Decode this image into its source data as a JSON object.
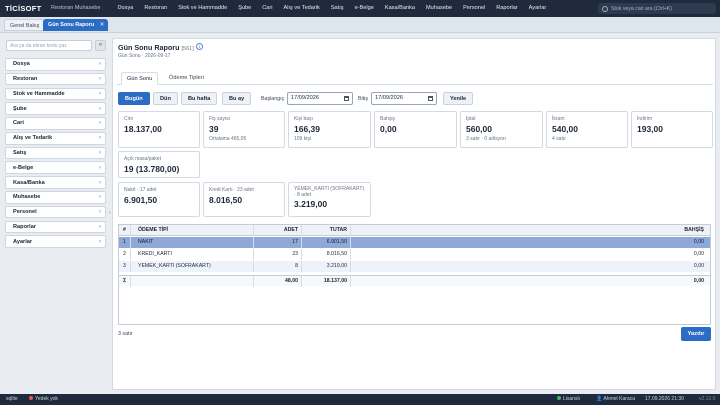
{
  "app": {
    "logo": "TİCİSOFT",
    "subtitle": "Restoran Muhasebe"
  },
  "menu": [
    "Dosya",
    "Restoran",
    "Stok ve Hammadde",
    "Şube",
    "Cari",
    "Alış ve Tedarik",
    "Satış",
    "e-Belge",
    "Kasa/Banka",
    "Muhasebe",
    "Personel",
    "Raporlar",
    "Ayarlar"
  ],
  "global_search": {
    "placeholder": "Stok veya cari ara (Ctrl+K)",
    "icon": "search-icon"
  },
  "page_tabs": [
    {
      "label": "Genel Bakış"
    },
    {
      "label": "Gün Sonu Raporu",
      "close": "✕"
    }
  ],
  "sidebar": {
    "search_placeholder": "Ara ya da ekran kodu yaz",
    "collapse": "«",
    "items": [
      "Dosya",
      "Restoran",
      "Stok ve Hammadde",
      "Şube",
      "Cari",
      "Alış ve Tedarik",
      "Satış",
      "e-Belge",
      "Kasa/Banka",
      "Muhasebe",
      "Personel",
      "Raporlar",
      "Ayarlar"
    ],
    "chevron": "›",
    "splitter": "‹"
  },
  "report": {
    "title": "Gün Sonu Raporu",
    "code": "[561]",
    "info": "i",
    "subtitle": "Gün Sonu · 2026-09-17",
    "tabs": [
      "Gün Sonu",
      "Ödeme Tipleri"
    ]
  },
  "filters": {
    "quick": [
      "Bugün",
      "Dün",
      "Bu hafta",
      "Bu ay"
    ],
    "start_label": "Başlangıç",
    "start_date": "17/09/2026",
    "end_label": "Bitiş",
    "end_date": "17/09/2026",
    "refresh": "Yenile"
  },
  "cards": {
    "ciro": {
      "label": "Ciro",
      "value": "18.137,00"
    },
    "fis": {
      "label": "Fiş sayısı",
      "value": "39",
      "sub": "Ortalama 465,05"
    },
    "kisi": {
      "label": "Kişi başı",
      "value": "166,39",
      "sub": "109 kişi"
    },
    "bahsis": {
      "label": "Bahşiş",
      "value": "0,00"
    },
    "iptal": {
      "label": "İptal",
      "value": "560,00",
      "sub": "3 satır · 0 adisyon"
    },
    "ikram": {
      "label": "İkram",
      "value": "540,00",
      "sub": "4 satır"
    },
    "indirim": {
      "label": "İndirim",
      "value": "193,00"
    },
    "acik": {
      "label": "Açık masa/paket",
      "value": "19 (13.780,00)"
    },
    "nakit": {
      "label": "Nakit · 17 adet",
      "value": "6.901,50"
    },
    "kredi": {
      "label": "Kredi Kartı · 23 adet",
      "value": "8.016,50"
    },
    "yemek": {
      "label": "YEMEK_KARTI (SOFRAKART)",
      "label2": "· 8 adet",
      "value": "3.219,00"
    }
  },
  "table": {
    "headers": [
      "#",
      "ÖDEME TİPİ",
      "ADET",
      "TUTAR",
      "BAHŞİŞ"
    ],
    "rows": [
      [
        "1",
        "NAKIT",
        "17",
        "6.901,50",
        "0,00"
      ],
      [
        "2",
        "KREDI_KARTI",
        "23",
        "8.016,50",
        "0,00"
      ],
      [
        "3",
        "YEMEK_KARTI (SOFRAKART)",
        "8",
        "3.219,00",
        "0,00"
      ]
    ],
    "footer": [
      "Σ",
      "",
      "48,00",
      "18.137,00",
      "0,00"
    ],
    "row_count": "3 satır"
  },
  "print_button": "Yazdır",
  "status": {
    "left": "sqlite",
    "backup": "Yedek yok",
    "license": "Lisanslı",
    "user": "Ahmet Karaca",
    "datetime": "17.09.2026 21:30",
    "version": "v2.12.0"
  },
  "colors": {
    "accent": "#2b6cc4",
    "topbar": "#1f2b3d",
    "selected_row": "#8ea8d8",
    "warn": "#e05a4f",
    "ok": "#3fb36b"
  }
}
